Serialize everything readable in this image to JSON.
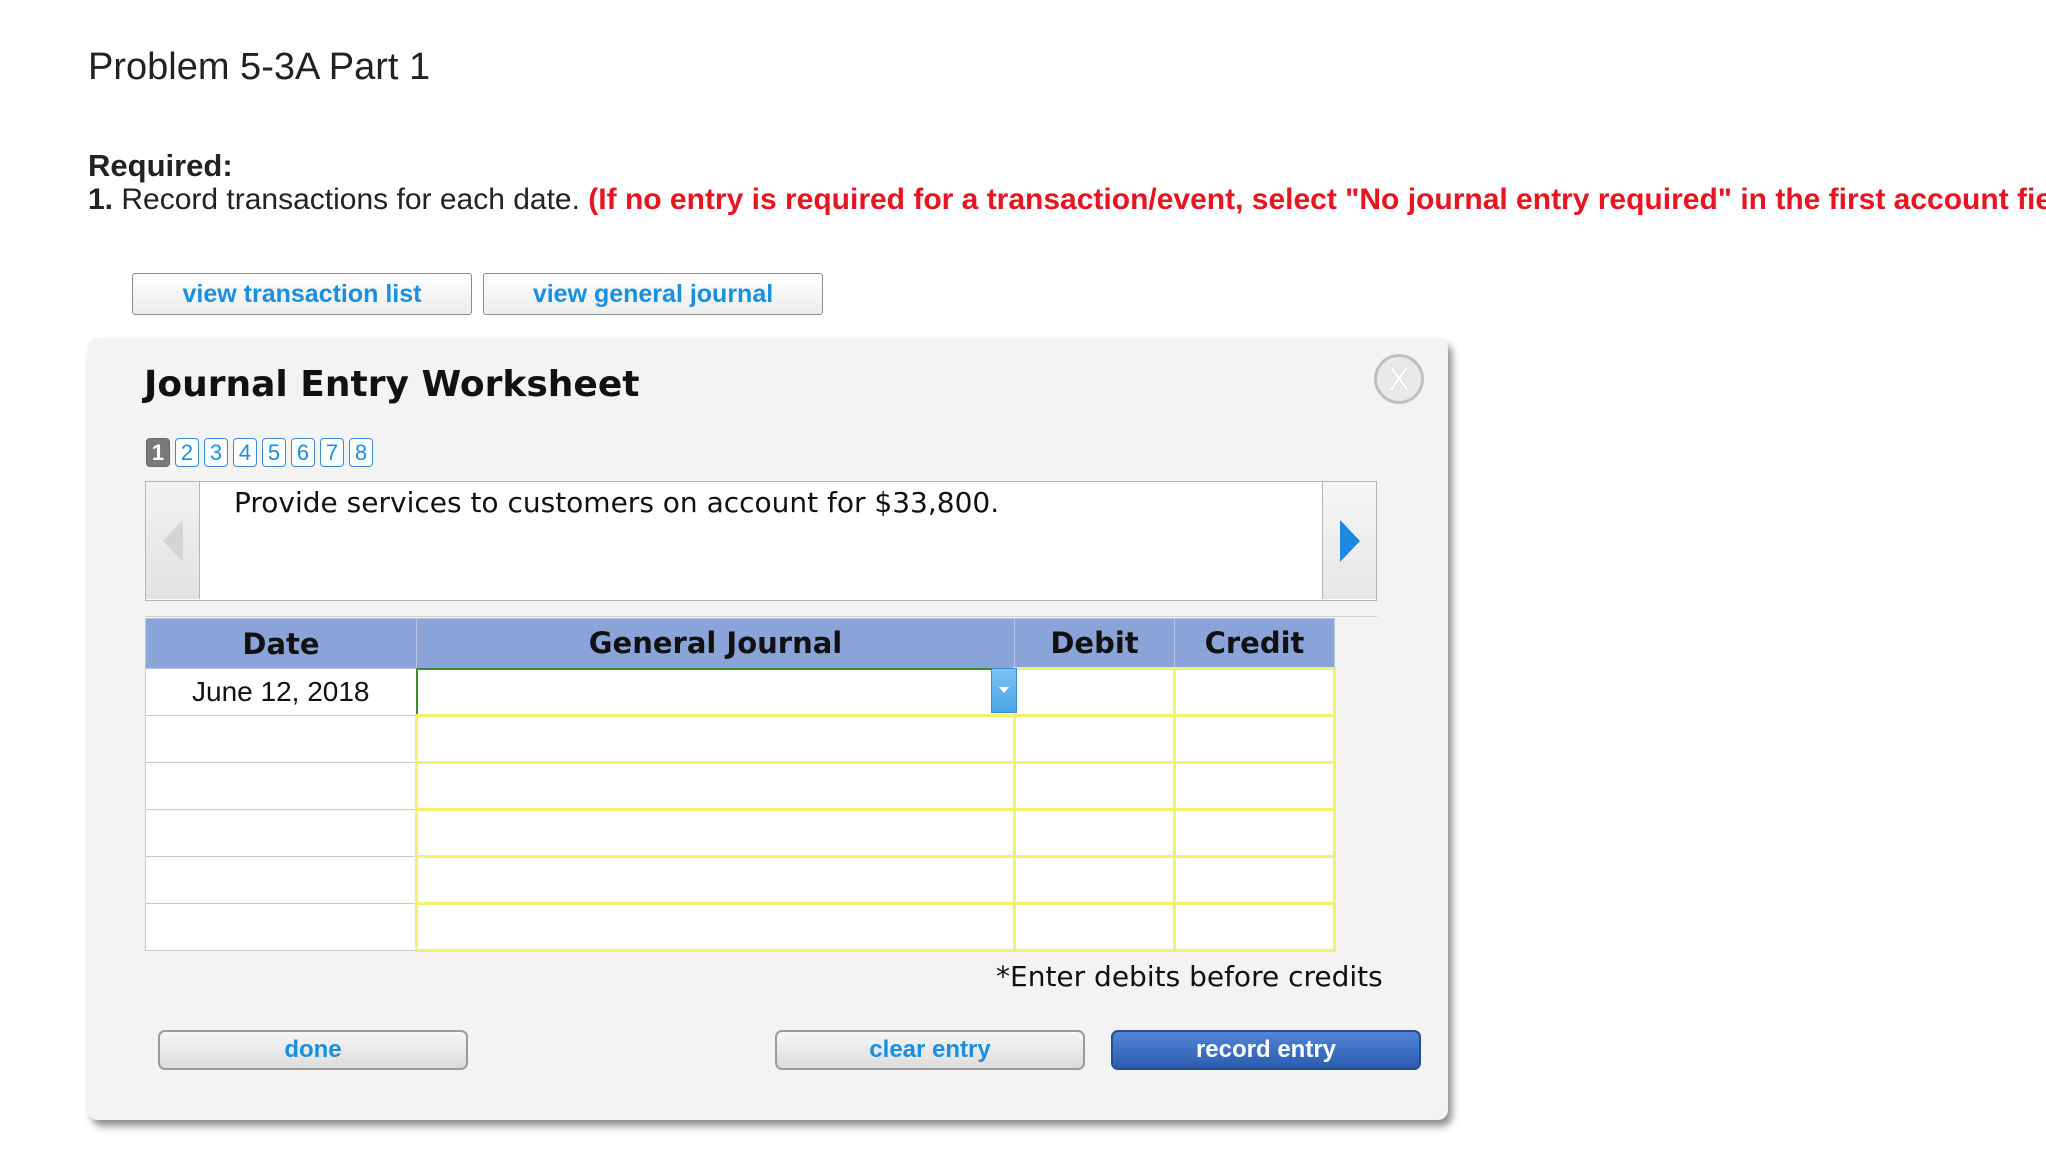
{
  "page": {
    "title": "Problem 5-3A Part 1",
    "required_label": "Required:",
    "instruction_number": "1.",
    "instruction_text": " Record transactions for each date. ",
    "instruction_note": "(If no entry is required for a transaction/event, select \"No journal entry required\" in the first account field.)"
  },
  "top_buttons": {
    "view_transaction_list": "view transaction list",
    "view_general_journal": "view general journal"
  },
  "worksheet": {
    "title": "Journal Entry Worksheet",
    "close_label": "X",
    "pages": [
      "1",
      "2",
      "3",
      "4",
      "5",
      "6",
      "7",
      "8"
    ],
    "active_page": "1",
    "description": "Provide services to customers on account for $33,800.",
    "table": {
      "headers": [
        "Date",
        "General Journal",
        "Debit",
        "Credit"
      ],
      "rows": [
        {
          "date": "June 12, 2018",
          "account": "",
          "debit": "",
          "credit": ""
        },
        {
          "date": "",
          "account": "",
          "debit": "",
          "credit": ""
        },
        {
          "date": "",
          "account": "",
          "debit": "",
          "credit": ""
        },
        {
          "date": "",
          "account": "",
          "debit": "",
          "credit": ""
        },
        {
          "date": "",
          "account": "",
          "debit": "",
          "credit": ""
        },
        {
          "date": "",
          "account": "",
          "debit": "",
          "credit": ""
        }
      ]
    },
    "note": "*Enter debits before credits",
    "buttons": {
      "done": "done",
      "clear_entry": "clear entry",
      "record_entry": "record entry"
    }
  },
  "colors": {
    "header_bg": "#8aa4d9",
    "link_blue": "#1a8fe0",
    "note_red": "#e8141f",
    "cell_border_yellow": "#f1f26a",
    "record_button": "#2d5cad"
  },
  "icons": {
    "prev": "chevron-left-icon",
    "next": "chevron-right-icon",
    "dropdown": "caret-down-icon",
    "close": "close-icon"
  }
}
